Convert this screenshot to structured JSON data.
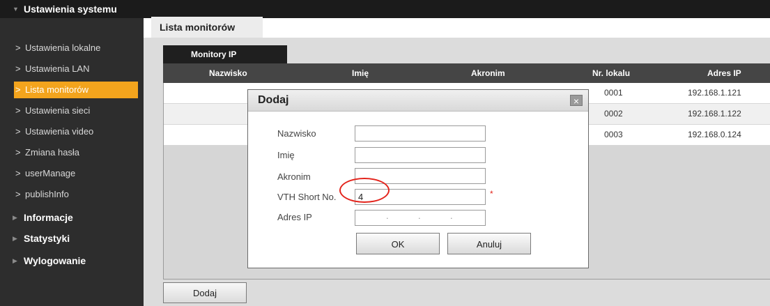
{
  "sidebar": {
    "sections": [
      {
        "label": "Ustawienia systemu",
        "expanded": true
      },
      {
        "label": "Informacje"
      },
      {
        "label": "Statystyki"
      },
      {
        "label": "Wylogowanie"
      }
    ],
    "items": [
      {
        "label": "Ustawienia lokalne"
      },
      {
        "label": "Ustawienia LAN"
      },
      {
        "label": "Lista monitorów",
        "active": true
      },
      {
        "label": "Ustawienia sieci"
      },
      {
        "label": "Ustawienia video"
      },
      {
        "label": "Zmiana hasła"
      },
      {
        "label": "userManage"
      },
      {
        "label": "publishInfo"
      }
    ],
    "chevron": ">"
  },
  "main": {
    "tab": "Lista monitorów",
    "subtab": "Monitory IP",
    "columns": [
      "Nazwisko",
      "Imię",
      "Akronim",
      "Nr. lokalu",
      "Adres IP"
    ],
    "rows": [
      {
        "nr": "0001",
        "ip": "192.168.1.121"
      },
      {
        "nr": "0002",
        "ip": "192.168.1.122"
      },
      {
        "nr": "0003",
        "ip": "192.168.0.124"
      }
    ],
    "add_button": "Dodaj"
  },
  "dialog": {
    "title": "Dodaj",
    "close_symbol": "×",
    "fields": [
      {
        "label": "Nazwisko",
        "value": ""
      },
      {
        "label": "Imię",
        "value": ""
      },
      {
        "label": "Akronim",
        "value": ""
      },
      {
        "label": "VTH Short No.",
        "value": "4",
        "required_mark": "*"
      },
      {
        "label": "Adres IP",
        "value": "",
        "ip_separator": "."
      }
    ],
    "ok_label": "OK",
    "cancel_label": "Anuluj"
  },
  "colors": {
    "accent": "#f3a41d",
    "sidebar_bg": "#2d2d2d",
    "header_bg": "#1b1b1b",
    "annotation": "#e3231b"
  },
  "icons": {
    "section_expanded": "triangle-down-icon",
    "section_collapsed": "triangle-right-icon",
    "item_chevron": "chevron-right-icon",
    "close": "close-icon"
  }
}
